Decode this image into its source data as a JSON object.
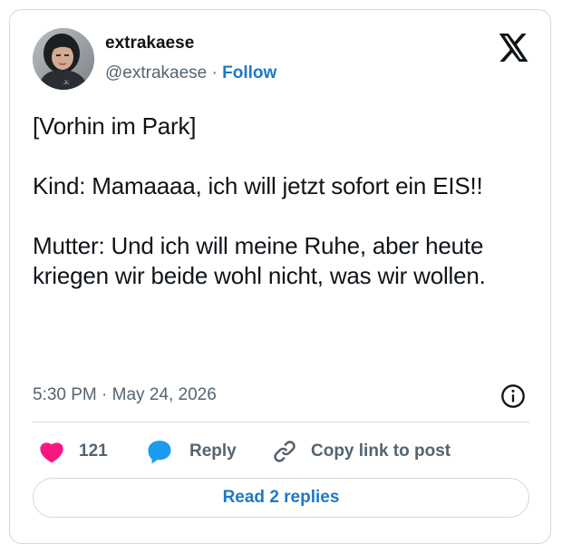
{
  "author": {
    "name": "extrakaese",
    "handle": "@extrakaese",
    "separator": "·",
    "follow_label": "Follow"
  },
  "tweet": {
    "paragraphs": [
      "[Vorhin im Park]",
      "Kind: Mamaaaa, ich will jetzt sofort ein EIS!!",
      "Mutter: Und ich will meine Ruhe, aber heute kriegen wir beide wohl nicht, was wir wollen."
    ],
    "time": "5:30 PM",
    "separator": "·",
    "date": "May 24, 2026"
  },
  "actions": {
    "like_count": "121",
    "reply_label": "Reply",
    "copy_link_label": "Copy link to post"
  },
  "read_replies_label": "Read 2 replies",
  "colors": {
    "accent": "#1d79c7",
    "like": "#f91880",
    "reply_icon": "#1d9bf0",
    "text": "#0f1419",
    "muted": "#536471",
    "border": "#cfd9de"
  },
  "icons": {
    "brand": "x-logo-icon",
    "info": "info-icon",
    "like": "heart-icon",
    "reply": "reply-bubble-icon",
    "copy": "link-icon"
  }
}
